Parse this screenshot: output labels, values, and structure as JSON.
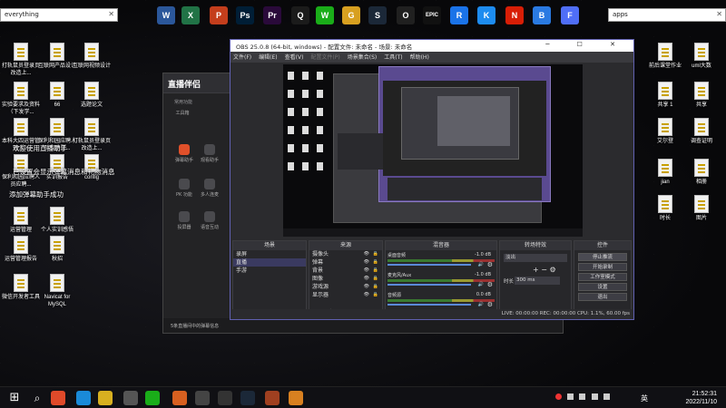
{
  "search_left": {
    "value": "everything"
  },
  "search_right": {
    "value": "apps"
  },
  "top_apps": [
    {
      "icon": "word-icon",
      "glyph": "W",
      "color": "#2b579a"
    },
    {
      "icon": "excel-icon",
      "glyph": "X",
      "color": "#217346"
    },
    {
      "icon": "powerpoint-icon",
      "glyph": "P",
      "color": "#c43e1c"
    },
    {
      "icon": "photoshop-icon",
      "glyph": "Ps",
      "color": "#001e36"
    },
    {
      "icon": "premiere-icon",
      "glyph": "Pr",
      "color": "#2a0a3a"
    },
    {
      "icon": "qq-icon",
      "glyph": "Q",
      "color": "#1b1b1b"
    },
    {
      "icon": "wechat-icon",
      "glyph": "W",
      "color": "#1aad19"
    },
    {
      "icon": "game-icon",
      "glyph": "G",
      "color": "#d8a020"
    },
    {
      "icon": "steam-icon",
      "glyph": "S",
      "color": "#1b2838"
    },
    {
      "icon": "obs-icon",
      "glyph": "O",
      "color": "#202020"
    },
    {
      "icon": "epic-games-icon",
      "glyph": "EPIC",
      "color": "#111"
    },
    {
      "icon": "remote-icon",
      "glyph": "R",
      "color": "#1a73e8"
    },
    {
      "icon": "kugou-icon",
      "glyph": "K",
      "color": "#1d8cf0"
    },
    {
      "icon": "netease-music-icon",
      "glyph": "N",
      "color": "#d81e06"
    },
    {
      "icon": "baidu-pan-icon",
      "glyph": "B",
      "color": "#2a7ae2"
    },
    {
      "icon": "feishu-icon",
      "glyph": "F",
      "color": "#4f6ef7"
    }
  ],
  "desktop_left": [
    {
      "label": "打轨鼠员登录页 改造上..."
    },
    {
      "label": "互联网产品设计"
    },
    {
      "label": "互联网视频设计"
    },
    {
      "label": "实验要求及资料（下发学..."
    },
    {
      "label": "66"
    },
    {
      "label": "选题论文"
    },
    {
      "label": "本科大四运营管理大..."
    },
    {
      "label": "保利和园应聘人员应聘登..."
    },
    {
      "label": "打轨鼠员登录页 改造上..."
    },
    {
      "label": "保利和园应聘人员应聘..."
    },
    {
      "label": "实训报告"
    },
    {
      "label": "config"
    },
    {
      "label": "运营管理"
    },
    {
      "label": "个人实训感悟"
    },
    {
      "label": "运营管理报告"
    },
    {
      "label": "秋招"
    },
    {
      "label": "微信开发者工具"
    },
    {
      "label": "Navicat for MySQL"
    }
  ],
  "desktop_right": [
    {
      "label": "前后课堂作业"
    },
    {
      "label": "uml大数"
    },
    {
      "label": "共享 1"
    },
    {
      "label": "共享"
    },
    {
      "label": "艾尔登"
    },
    {
      "label": "调查证明"
    },
    {
      "label": "jian"
    },
    {
      "label": "相册"
    },
    {
      "label": "时长"
    },
    {
      "label": "图片"
    }
  ],
  "overlay": {
    "line1": "欢迎使用直播助手",
    "line2": "已设置会显示弹幕消息和礼物消息",
    "line3": "添加弹幕助手成功"
  },
  "live_app": {
    "logo": "直播伴侣",
    "tabs": "常用功能",
    "sidebar": [
      {
        "label": "工具箱"
      },
      {
        "label": "弹幕助手"
      },
      {
        "label": "观看助手"
      },
      {
        "label": "PK 功能"
      },
      {
        "label": "多人连麦"
      },
      {
        "label": "投屏器"
      },
      {
        "label": "语音互动"
      }
    ],
    "footer": "5条直播间中的弹幕信息"
  },
  "obs": {
    "title": "OBS 25.0.8 (64-bit, windows) - 配置文件: 未命名 - 场景: 未命名",
    "menu": [
      "文件(F)",
      "编辑(E)",
      "查看(V)",
      "配置文件(P)",
      "场景集合(S)",
      "工具(T)",
      "帮助(H)"
    ],
    "scenes_header": "场景",
    "scenes": [
      "录屏",
      "直播",
      "手游"
    ],
    "sources_header": "来源",
    "sources": [
      {
        "label": "摄像头"
      },
      {
        "label": "弹幕"
      },
      {
        "label": "背景"
      },
      {
        "label": "图像"
      },
      {
        "label": "游戏源"
      },
      {
        "label": "显示器"
      }
    ],
    "mixer_header": "混音器",
    "mixer": [
      {
        "name": "桌面音频",
        "db": "-1.0 dB"
      },
      {
        "name": "麦克风/Aux",
        "db": "-1.0 dB"
      },
      {
        "name": "音频源",
        "db": "0.0 dB"
      }
    ],
    "transitions_header": "转场特效",
    "transition_type": "淡出",
    "duration_label": "时长",
    "duration_value": "300 ms",
    "controls_header": "控件",
    "controls": [
      "停止推流",
      "开始录制",
      "工作室模式",
      "设置",
      "退出"
    ],
    "status": "LIVE: 00:00:00   REC: 00:00:00   CPU: 1.1%, 60.00 fps"
  },
  "taskbar": {
    "icons": [
      "windows-start-icon",
      "search-icon",
      "chrome-icon",
      "edge-icon",
      "file-explorer-icon",
      "app-icon",
      "wechat-icon",
      "browser-icon",
      "obs-icon",
      "game-icon",
      "steam-icon",
      "app-icon",
      "app-icon"
    ],
    "lang": "英",
    "time": "21:52:31",
    "date": "2022/11/10"
  }
}
